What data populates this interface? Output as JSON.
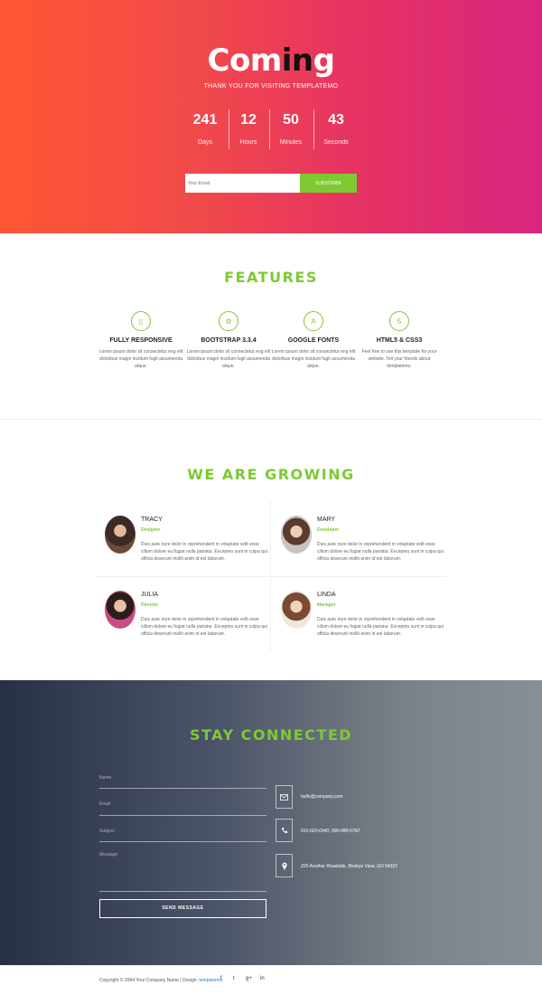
{
  "hero": {
    "title_prefix": "Com",
    "title_highlight": "in",
    "title_suffix": "g",
    "subtitle": "THANK YOU FOR VISITING TEMPLATEMO",
    "countdown": [
      {
        "value": "241",
        "label": "Days"
      },
      {
        "value": "12",
        "label": "Hours"
      },
      {
        "value": "50",
        "label": "Minutes"
      },
      {
        "value": "43",
        "label": "Seconds"
      }
    ],
    "email_placeholder": "Your Email",
    "subscribe_label": "SUBSCRIBE"
  },
  "features": {
    "title": "FEATURES",
    "items": [
      {
        "icon": "mobile-icon",
        "glyph": "▯",
        "title": "FULLY RESPONSIVE",
        "text": "Lorem ipsum dolor sit consectetur eng elit doloribus magni incidunt fugit assumenda atque."
      },
      {
        "icon": "cogs-icon",
        "glyph": "⚙",
        "title": "BOOTSTRAP 3.3.4",
        "text": "Lorem ipsum dolor sit consectetur eng elit doloribus magni incidunt fugit assumenda atque."
      },
      {
        "icon": "font-icon",
        "glyph": "A",
        "title": "GOOGLE FONTS",
        "text": "Lorem ipsum dolor sit consectetur eng elit doloribus magni incidunt fugit assumenda atque."
      },
      {
        "icon": "html5-icon",
        "glyph": "5",
        "title": "HTML5 & CSS3",
        "text": "Feel free to use this template for your website. Tell your friends about templatemo."
      }
    ]
  },
  "team": {
    "title": "WE ARE GROWING",
    "members": [
      {
        "name": "TRACY",
        "role": "Designer",
        "text": "Duis aute irure dolor in reprehenderit in voluptate velit esse cillum dolore eu fugiat nulla pariatur. Excepteu sunt in culpa qui officia deserunt mollit anim id est laborum."
      },
      {
        "name": "MARY",
        "role": "Developer",
        "text": "Duis aute irure dolor in reprehenderit in voluptate velit esse cillum dolore eu fugiat nulla pariatur. Excepteu sunt in culpa qui officia deserunt mollit anim id est laborum."
      },
      {
        "name": "JULIA",
        "role": "Director",
        "text": "Duis aute irure dolor in reprehenderit in voluptate velit esse cillum dolore eu fugiat nulla pariatur. Excepteu sunt in culpa qui officia deserunt mollit anim id est laborum."
      },
      {
        "name": "LINDA",
        "role": "Manager",
        "text": "Duis aute irure dolor in reprehenderit in voluptate velit esse cillum dolore eu fugiat nulla pariatur. Excepteu sunt in culpa qui officia deserunt mollit anim id est laborum."
      }
    ]
  },
  "contact": {
    "title": "STAY CONNECTED",
    "fields": {
      "name": "Name",
      "email": "Email",
      "subject": "Subject",
      "message": "Message"
    },
    "send_label": "SEND MESSAGE",
    "info": [
      {
        "icon": "envelope-icon",
        "glyph": "✉",
        "text": "hello@company.com"
      },
      {
        "icon": "phone-icon",
        "glyph": "✆",
        "text": "010-020-0340, 090-080-0760"
      },
      {
        "icon": "map-marker-icon",
        "glyph": "⚲",
        "text": "220 Another Roadside, Birdeye View, GO 54321"
      }
    ]
  },
  "footer": {
    "copyright": "Copyright © 2084 Your Company Name | Design: ",
    "design_link": "templatemo",
    "social": [
      {
        "icon": "facebook-icon",
        "glyph": "f"
      },
      {
        "icon": "twitter-icon",
        "glyph": "t"
      },
      {
        "icon": "google-plus-icon",
        "glyph": "g+"
      },
      {
        "icon": "linkedin-icon",
        "glyph": "in"
      }
    ]
  },
  "colors": {
    "accent": "#7ec933",
    "hero_start": "#ff5733",
    "hero_end": "#da2680",
    "contact_start": "#283048",
    "contact_end": "#869195"
  }
}
